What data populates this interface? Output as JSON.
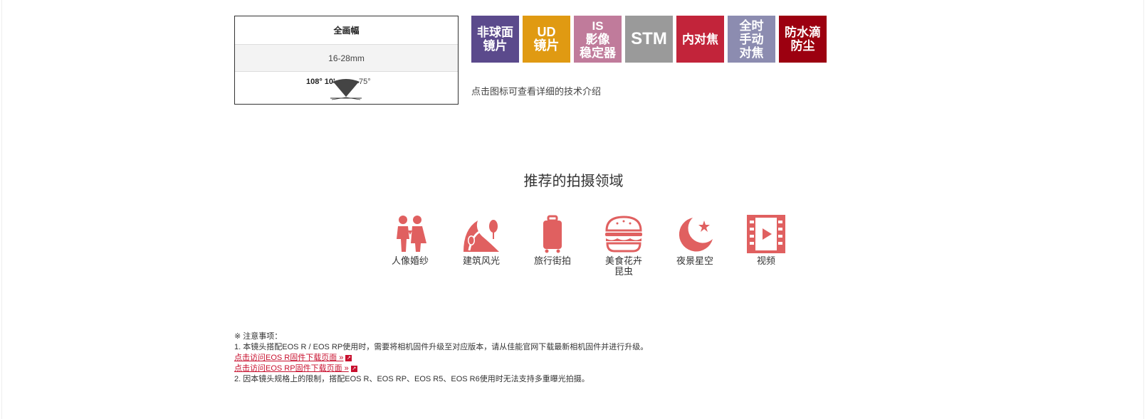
{
  "spec": {
    "frame_type": "全画幅",
    "focal_length": "16-28mm",
    "angle_left": "108° 10'",
    "angle_right": "75°"
  },
  "badges": [
    {
      "label": "非球面\n镜片",
      "color": "#5b4a8c"
    },
    {
      "label": "UD\n镜片",
      "color": "#e09a12"
    },
    {
      "label": "IS\n影像\n稳定器",
      "color": "#c07b9b"
    },
    {
      "label": "STM",
      "color": "#9a9a9a"
    },
    {
      "label": "内对焦",
      "color": "#c2243a"
    },
    {
      "label": "全时\n手动\n对焦",
      "color": "#8c8cb0"
    },
    {
      "label": "防水滴\n防尘",
      "color": "#9c0010"
    }
  ],
  "hint": "点击图标可查看详细的技术介绍",
  "section_title": "推荐的拍摄领域",
  "scene_color": "#e06060",
  "scenes": [
    {
      "icon": "couple-icon",
      "label": "人像婚纱"
    },
    {
      "icon": "landscape-icon",
      "label": "建筑风光"
    },
    {
      "icon": "suitcase-icon",
      "label": "旅行街拍"
    },
    {
      "icon": "burger-icon",
      "label": "美食花卉\n昆虫"
    },
    {
      "icon": "moon-star-icon",
      "label": "夜景星空"
    },
    {
      "icon": "film-icon",
      "label": "视频"
    }
  ],
  "notes": {
    "heading": "※ 注意事项：",
    "item1": "1. 本镜头搭配EOS R / EOS RP使用时，需要将相机固件升级至对应版本，请从佳能官网下载最新相机固件并进行升级。",
    "link1": "点击访问EOS R固件下载页面 »",
    "link2": "点击访问EOS RP固件下载页面 »",
    "item2": "2. 因本镜头规格上的限制，搭配EOS R、EOS RP、EOS R5、EOS R6使用时无法支持多重曝光拍摄。"
  }
}
